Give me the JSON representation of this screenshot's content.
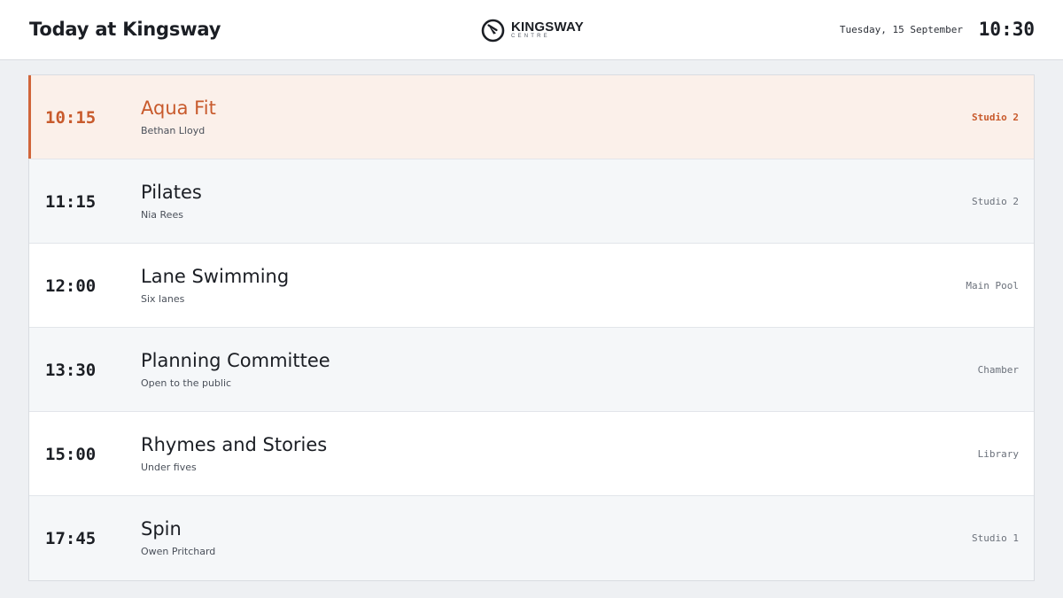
{
  "header": {
    "title": "Today at Kingsway",
    "logo": {
      "name": "KINGSWAY",
      "sub": "CENTRE",
      "icon": "kingsway-logo-mark"
    },
    "date": "Tuesday, 15 September",
    "time": "10:30"
  },
  "colors": {
    "accent": "#d0653a",
    "current_bg": "#fbf0ea",
    "alt_row_bg": "#f5f7f9",
    "page_bg": "#eef0f3"
  },
  "schedule": [
    {
      "time": "10:15",
      "title": "Aqua Fit",
      "subtitle": "Bethan Lloyd",
      "venue": "Studio 2",
      "current": true
    },
    {
      "time": "11:15",
      "title": "Pilates",
      "subtitle": "Nia Rees",
      "venue": "Studio 2",
      "current": false
    },
    {
      "time": "12:00",
      "title": "Lane Swimming",
      "subtitle": "Six lanes",
      "venue": "Main Pool",
      "current": false
    },
    {
      "time": "13:30",
      "title": "Planning Committee",
      "subtitle": "Open to the public",
      "venue": "Chamber",
      "current": false
    },
    {
      "time": "15:00",
      "title": "Rhymes and Stories",
      "subtitle": "Under fives",
      "venue": "Library",
      "current": false
    },
    {
      "time": "17:45",
      "title": "Spin",
      "subtitle": "Owen Pritchard",
      "venue": "Studio 1",
      "current": false
    }
  ]
}
